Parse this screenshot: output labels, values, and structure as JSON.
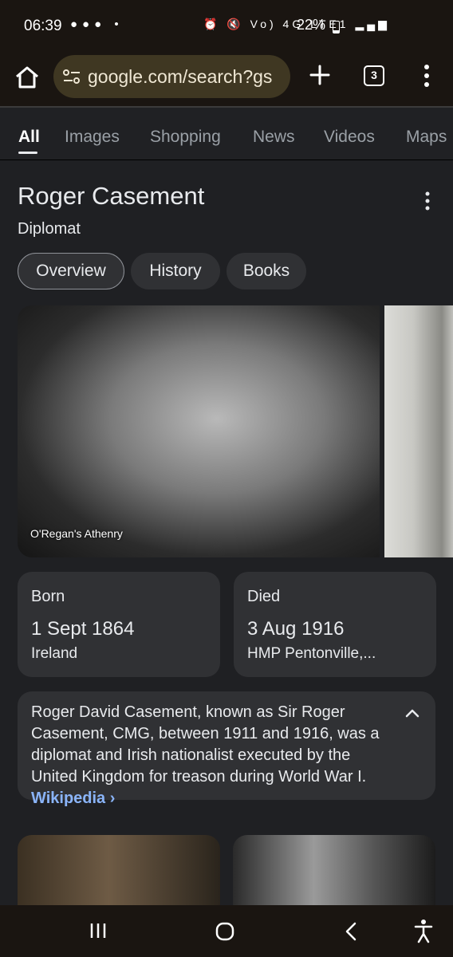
{
  "status_bar": {
    "time": "06:39",
    "battery": "22%",
    "network": "Vo) 4G LTE1",
    "icons": [
      "notification-icon",
      "hearing-icon",
      "line-icon",
      "dot-icon",
      "alarm-icon",
      "mute-icon",
      "signal-icon"
    ]
  },
  "browser": {
    "url": "google.com/search?gs",
    "tab_count": "3"
  },
  "search_tabs": [
    "All",
    "Images",
    "Shopping",
    "News",
    "Videos",
    "Maps"
  ],
  "knowledge_panel": {
    "title": "Roger Casement",
    "subtitle": "Diplomat",
    "chips": [
      "Overview",
      "History",
      "Books"
    ],
    "photo_caption": "O'Regan's Athenry",
    "born": {
      "label": "Born",
      "date": "1 Sept 1864",
      "place": "Ireland"
    },
    "died": {
      "label": "Died",
      "date": "3 Aug 1916",
      "place": "HMP Pentonville,..."
    },
    "description": "Roger David Casement, known as Sir Roger Casement, CMG, between 1911 and 1916, was a diplomat and Irish nationalist executed by the United Kingdom for treason during World War I.",
    "source_link": "Wikipedia ›"
  },
  "colors": {
    "background": "#1f2023",
    "card": "#303134",
    "link": "#8ab4f8",
    "url_pill": "#3f3722"
  }
}
